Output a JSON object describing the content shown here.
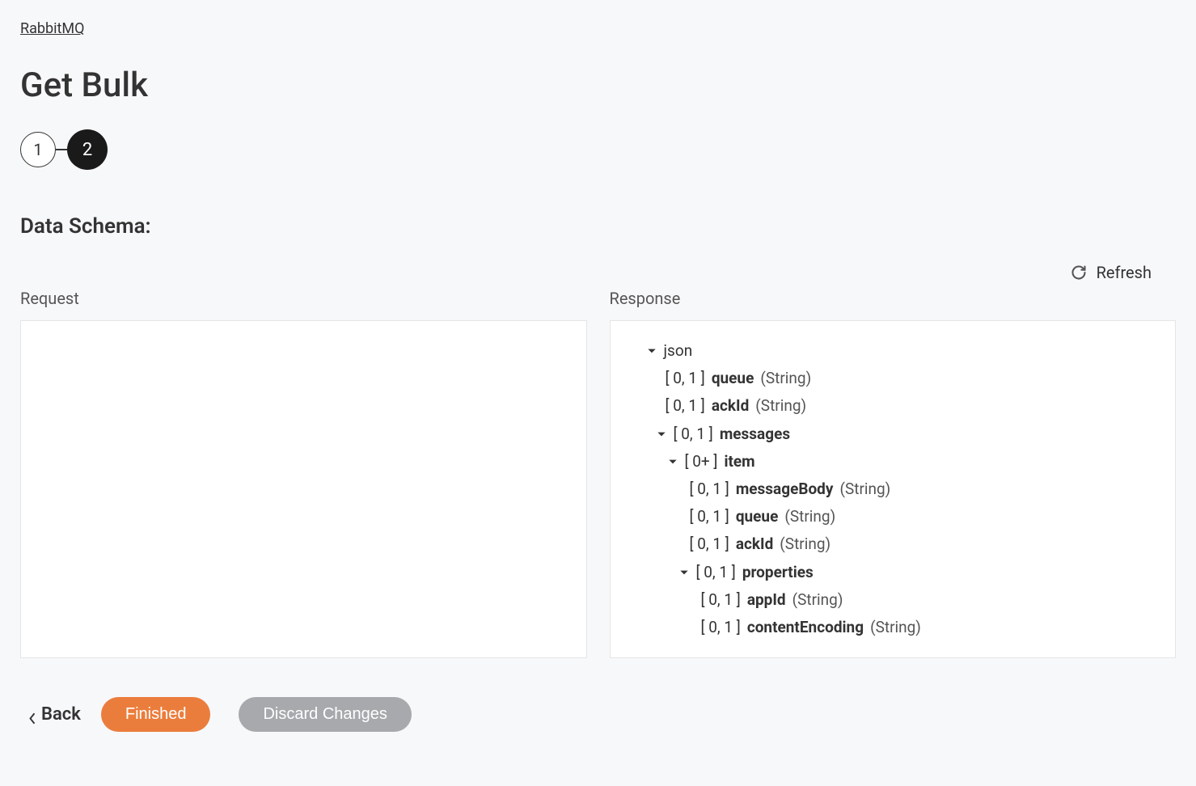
{
  "breadcrumb": {
    "label": "RabbitMQ"
  },
  "page": {
    "title": "Get Bulk"
  },
  "stepper": {
    "steps": [
      "1",
      "2"
    ],
    "active_index": 1
  },
  "section": {
    "title": "Data Schema:"
  },
  "refresh": {
    "label": "Refresh"
  },
  "panels": {
    "request_label": "Request",
    "response_label": "Response"
  },
  "response_tree": {
    "root": "json",
    "fields": [
      {
        "cardinality": "[ 0, 1 ]",
        "name": "queue",
        "type": "(String)"
      },
      {
        "cardinality": "[ 0, 1 ]",
        "name": "ackId",
        "type": "(String)"
      }
    ],
    "messages": {
      "cardinality": "[ 0, 1 ]",
      "name": "messages",
      "item": {
        "cardinality": "[ 0+ ]",
        "name": "item",
        "fields": [
          {
            "cardinality": "[ 0, 1 ]",
            "name": "messageBody",
            "type": "(String)"
          },
          {
            "cardinality": "[ 0, 1 ]",
            "name": "queue",
            "type": "(String)"
          },
          {
            "cardinality": "[ 0, 1 ]",
            "name": "ackId",
            "type": "(String)"
          }
        ],
        "properties": {
          "cardinality": "[ 0, 1 ]",
          "name": "properties",
          "fields": [
            {
              "cardinality": "[ 0, 1 ]",
              "name": "appId",
              "type": "(String)"
            },
            {
              "cardinality": "[ 0, 1 ]",
              "name": "contentEncoding",
              "type": "(String)"
            }
          ]
        }
      }
    }
  },
  "footer": {
    "back_label": "Back",
    "finished_label": "Finished",
    "discard_label": "Discard Changes"
  }
}
